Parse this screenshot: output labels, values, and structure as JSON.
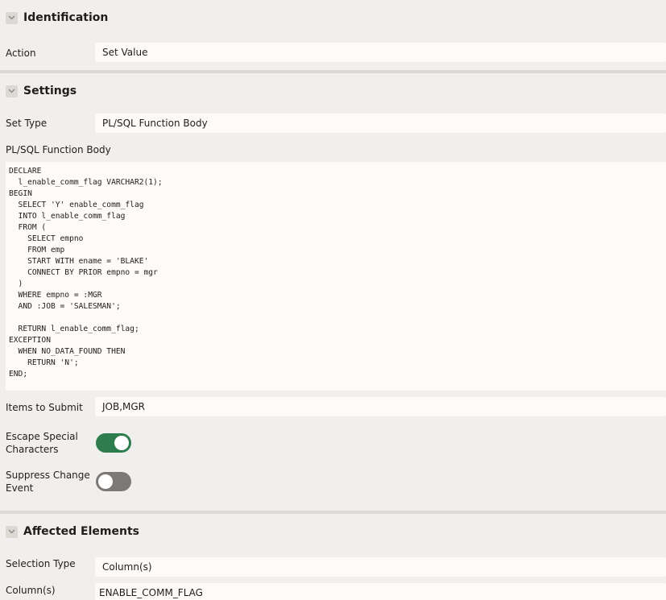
{
  "sections": {
    "identification": {
      "title": "Identification"
    },
    "settings": {
      "title": "Settings"
    },
    "affected": {
      "title": "Affected Elements"
    }
  },
  "identification": {
    "action_label": "Action",
    "action_value": "Set Value"
  },
  "settings": {
    "set_type_label": "Set Type",
    "set_type_value": "PL/SQL Function Body",
    "function_body_label": "PL/SQL Function Body",
    "code_lines": [
      "DECLARE",
      "  l_enable_comm_flag VARCHAR2(1);",
      "BEGIN",
      "  SELECT 'Y' enable_comm_flag",
      "  INTO l_enable_comm_flag",
      "  FROM (",
      "    SELECT empno",
      "    FROM emp",
      "    START WITH ename = 'BLAKE'",
      "    CONNECT BY PRIOR empno = mgr",
      "  )",
      "  WHERE empno = :MGR",
      "  AND :JOB = 'SALESMAN';",
      "",
      "  RETURN l_enable_comm_flag;",
      "EXCEPTION",
      "  WHEN NO_DATA_FOUND THEN",
      "    RETURN 'N';",
      "END;"
    ],
    "items_to_submit_label": "Items to Submit",
    "items_to_submit_value": "JOB,MGR",
    "escape_label_1": "Escape Special",
    "escape_label_2": "Characters",
    "escape_on": true,
    "suppress_label_1": "Suppress Change",
    "suppress_label_2": "Event",
    "suppress_on": false
  },
  "affected": {
    "selection_type_label": "Selection Type",
    "selection_type_value": "Column(s)",
    "columns_label": "Column(s)",
    "columns_value": "ENABLE_COMM_FLAG"
  },
  "colors": {
    "toggle_on": "#2f7c4f",
    "toggle_off": "#7b7875",
    "background": "#f1efed",
    "field": "#fcfbfa"
  }
}
